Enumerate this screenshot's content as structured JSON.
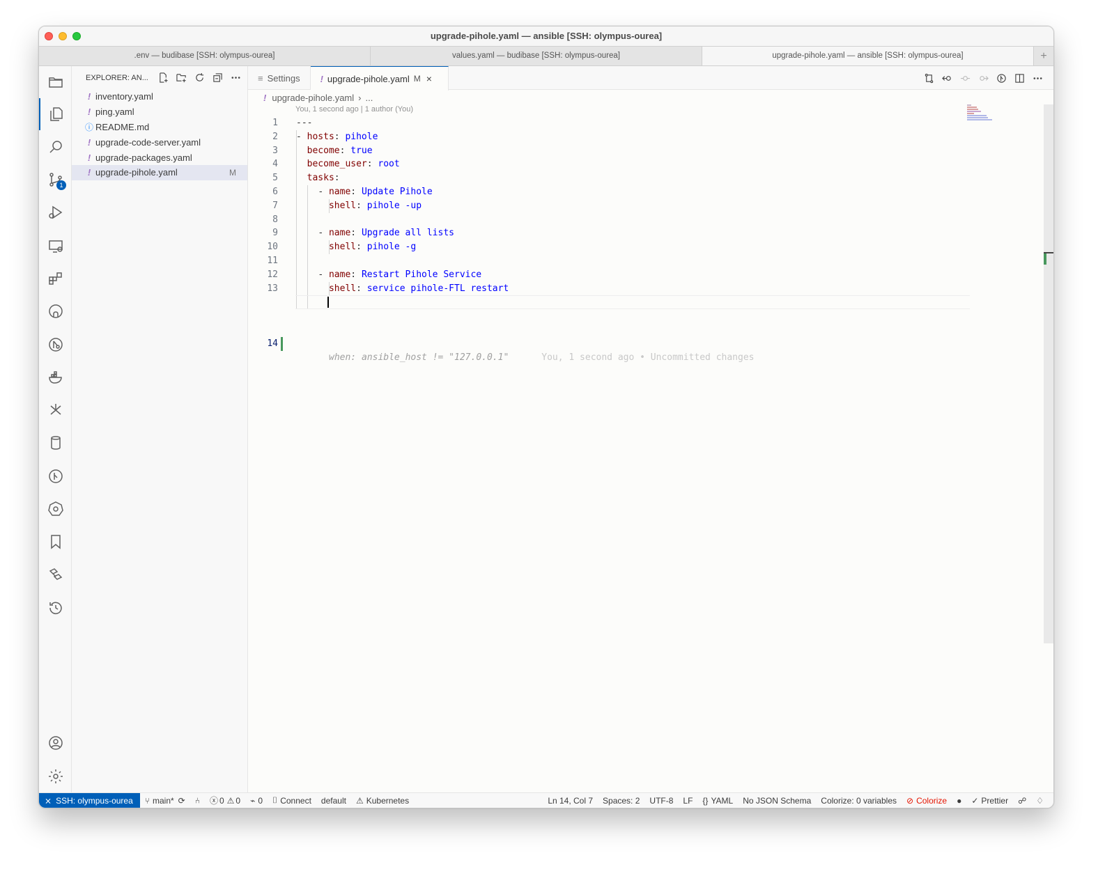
{
  "window": {
    "title": "upgrade-pihole.yaml — ansible [SSH: olympus-ourea]",
    "tabs": [
      ".env — budibase [SSH: olympus-ourea]",
      "values.yaml — budibase [SSH: olympus-ourea]",
      "upgrade-pihole.yaml — ansible [SSH: olympus-ourea]"
    ],
    "new_tab": "+"
  },
  "activitybar": {
    "scm_badge": "1"
  },
  "sidebar": {
    "title": "EXPLORER: AN...",
    "files": [
      {
        "icon": "!",
        "name": "inventory.yaml",
        "status": ""
      },
      {
        "icon": "!",
        "name": "ping.yaml",
        "status": ""
      },
      {
        "icon": "ⓘ",
        "name": "README.md",
        "status": ""
      },
      {
        "icon": "!",
        "name": "upgrade-code-server.yaml",
        "status": ""
      },
      {
        "icon": "!",
        "name": "upgrade-packages.yaml",
        "status": ""
      },
      {
        "icon": "!",
        "name": "upgrade-pihole.yaml",
        "status": "M"
      }
    ]
  },
  "editor": {
    "tabs": [
      {
        "icon": "≡",
        "label": "Settings"
      },
      {
        "icon": "!",
        "label": "upgrade-pihole.yaml",
        "modified": "M",
        "close": "×"
      }
    ],
    "breadcrumb": {
      "icon": "!",
      "file": "upgrade-pihole.yaml",
      "sep": "›",
      "rest": "..."
    },
    "codelens": "You, 1 second ago | 1 author (You)",
    "lines": [
      {
        "n": "1",
        "dash": "",
        "indent": "",
        "key": "",
        "colon": "---",
        "value": ""
      },
      {
        "n": "2",
        "dash": "- ",
        "indent": "",
        "key": "hosts",
        "colon": ": ",
        "value": "pihole"
      },
      {
        "n": "3",
        "dash": "",
        "indent": "  ",
        "key": "become",
        "colon": ": ",
        "value": "true"
      },
      {
        "n": "4",
        "dash": "",
        "indent": "  ",
        "key": "become_user",
        "colon": ": ",
        "value": "root"
      },
      {
        "n": "5",
        "dash": "",
        "indent": "  ",
        "key": "tasks",
        "colon": ":",
        "value": ""
      },
      {
        "n": "6",
        "dash": "- ",
        "indent": "    ",
        "key": "name",
        "colon": ": ",
        "value": "Update Pihole"
      },
      {
        "n": "7",
        "dash": "",
        "indent": "      ",
        "key": "shell",
        "colon": ": ",
        "value": "pihole -up"
      },
      {
        "n": "8",
        "dash": "",
        "indent": "",
        "key": "",
        "colon": "",
        "value": ""
      },
      {
        "n": "9",
        "dash": "- ",
        "indent": "    ",
        "key": "name",
        "colon": ": ",
        "value": "Upgrade all lists"
      },
      {
        "n": "10",
        "dash": "",
        "indent": "      ",
        "key": "shell",
        "colon": ": ",
        "value": "pihole -g"
      },
      {
        "n": "11",
        "dash": "",
        "indent": "",
        "key": "",
        "colon": "",
        "value": ""
      },
      {
        "n": "12",
        "dash": "- ",
        "indent": "    ",
        "key": "name",
        "colon": ": ",
        "value": "Restart Pihole Service"
      },
      {
        "n": "13",
        "dash": "",
        "indent": "      ",
        "key": "shell",
        "colon": ": ",
        "value": "service pihole-FTL restart"
      }
    ],
    "current_line": {
      "n": "14",
      "ghost": "when: ansible_host != \"127.0.0.1\"",
      "blame": "You, 1 second ago • Uncommitted changes"
    }
  },
  "statusbar": {
    "remote": "SSH: olympus-ourea",
    "branch": "main*",
    "errors": "0",
    "warnings": "0",
    "ports": "0",
    "connect": "Connect",
    "profile": "default",
    "kubernetes": "Kubernetes",
    "position": "Ln 14, Col 7",
    "spaces": "Spaces: 2",
    "encoding": "UTF-8",
    "eol": "LF",
    "language": "YAML",
    "schema": "No JSON Schema",
    "colorize_vars": "Colorize: 0 variables",
    "colorize": "Colorize",
    "prettier": "Prettier"
  },
  "colors": {
    "accent": "#005fb8",
    "yaml_key": "#800000",
    "yaml_value": "#0000ff",
    "git_added": "#48985d"
  }
}
